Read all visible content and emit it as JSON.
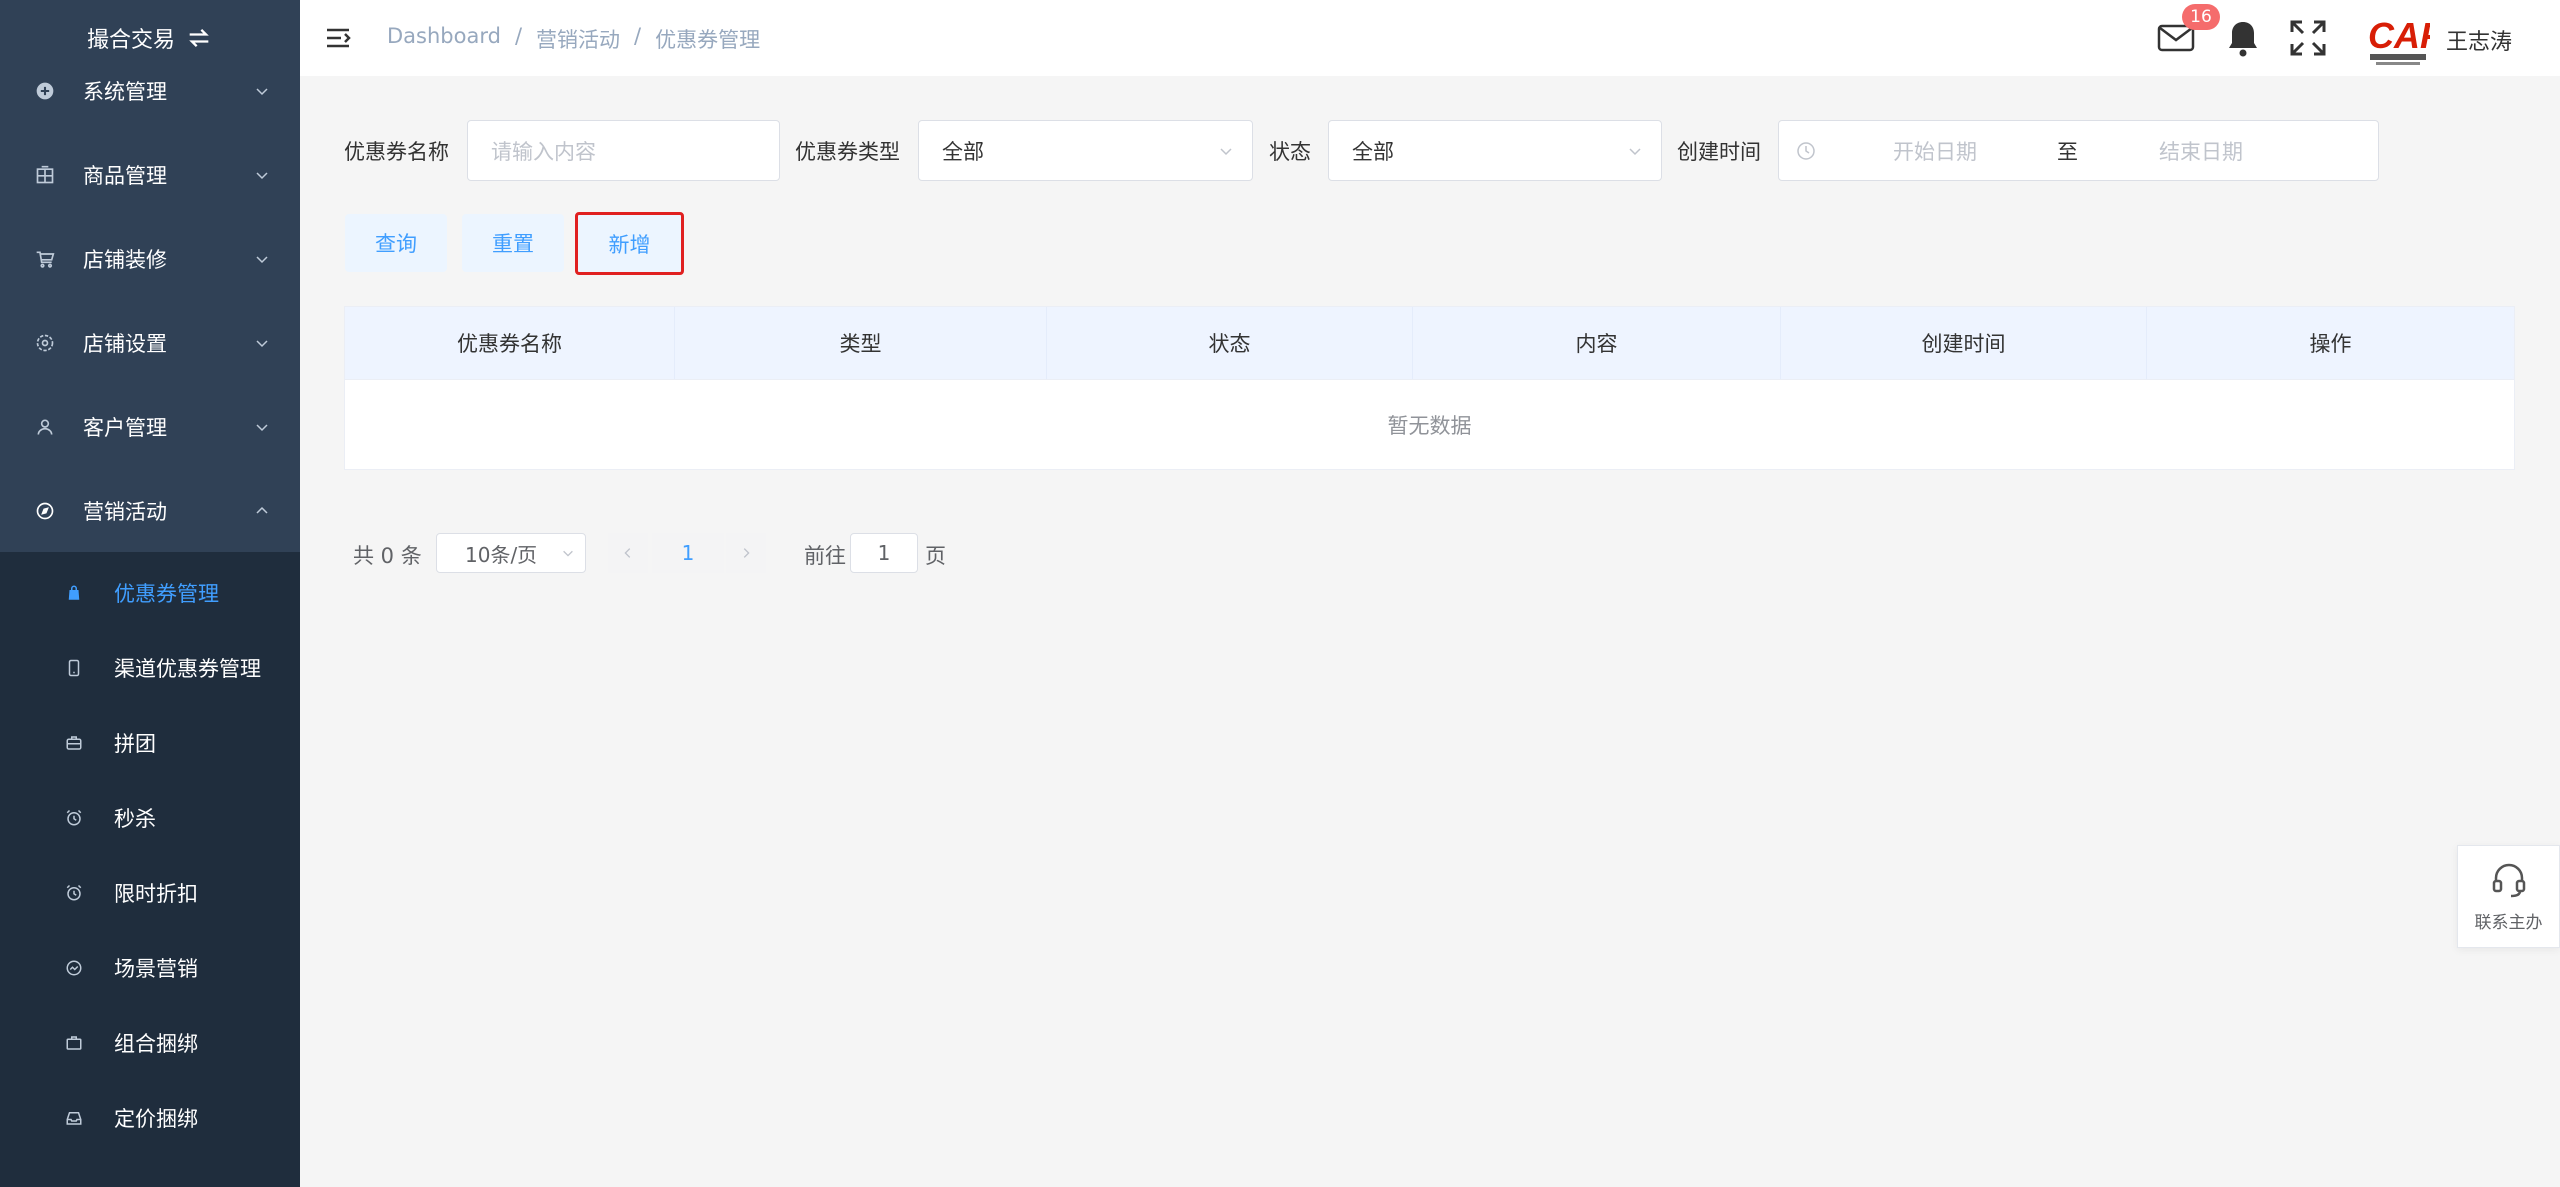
{
  "sidebar": {
    "brand": "撮合交易",
    "menu": [
      {
        "label": "系统管理",
        "icon": "plus-circle-icon"
      },
      {
        "label": "商品管理",
        "icon": "grid-icon"
      },
      {
        "label": "店铺装修",
        "icon": "cart-icon"
      },
      {
        "label": "店铺设置",
        "icon": "settings-icon"
      },
      {
        "label": "客户管理",
        "icon": "user-icon"
      },
      {
        "label": "营销活动",
        "icon": "compass-icon"
      }
    ],
    "submenu": [
      {
        "label": "优惠券管理",
        "icon": "bag-icon",
        "active": true
      },
      {
        "label": "渠道优惠券管理",
        "icon": "mobile-icon"
      },
      {
        "label": "拼团",
        "icon": "briefcase-icon"
      },
      {
        "label": "秒杀",
        "icon": "alarm-icon"
      },
      {
        "label": "限时折扣",
        "icon": "alarm-icon"
      },
      {
        "label": "场景营销",
        "icon": "chart-circle-icon"
      },
      {
        "label": "组合捆绑",
        "icon": "box-icon"
      },
      {
        "label": "定价捆绑",
        "icon": "tray-icon"
      }
    ]
  },
  "header": {
    "breadcrumb": [
      "Dashboard",
      "营销活动",
      "优惠券管理"
    ],
    "mail_badge": "16",
    "username": "王志涛",
    "logo_text": "CAF"
  },
  "filters": {
    "name_label": "优惠券名称",
    "name_placeholder": "请输入内容",
    "type_label": "优惠券类型",
    "type_value": "全部",
    "status_label": "状态",
    "status_value": "全部",
    "created_label": "创建时间",
    "start_placeholder": "开始日期",
    "range_sep": "至",
    "end_placeholder": "结束日期"
  },
  "buttons": {
    "query": "查询",
    "reset": "重置",
    "add": "新增"
  },
  "table": {
    "columns": [
      "优惠券名称",
      "类型",
      "状态",
      "内容",
      "创建时间",
      "操作"
    ],
    "empty_text": "暂无数据"
  },
  "pagination": {
    "total_text": "共 0 条",
    "page_size": "10条/页",
    "current_page": "1",
    "goto_label": "前往",
    "goto_value": "1",
    "goto_unit": "页"
  },
  "contact": {
    "label": "联系主办"
  },
  "colors": {
    "sidebar_bg": "#304156",
    "submenu_bg": "#1f2d3d",
    "accent": "#409eff",
    "highlight_border": "#e02020",
    "badge": "#f56c6c"
  }
}
